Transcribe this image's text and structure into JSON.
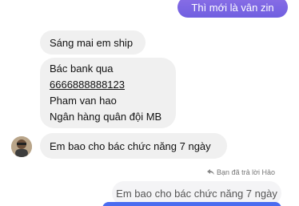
{
  "messages": {
    "outgoing_top": "Thì mới là vân zin",
    "incoming_1": "Sáng mai em ship",
    "incoming_2": {
      "line1": "Bác bank qua",
      "line2": "6666888888123",
      "line3": "Pham van hao",
      "line4": "Ngân hàng quân đội MB"
    },
    "incoming_3": "Em bao cho bác chức năng 7 ngày"
  },
  "reply": {
    "note": "Bạn đã trả lời Hảo",
    "quoted": "Em bao cho bác chức năng 7 ngày"
  },
  "icons": {
    "reply": "reply-arrow-icon",
    "avatar": "avatar"
  },
  "colors": {
    "outgoing_bubble": "#7a6ae0",
    "incoming_bubble": "#f0f0f0",
    "bottom_bubble": "#4a6cf0"
  }
}
